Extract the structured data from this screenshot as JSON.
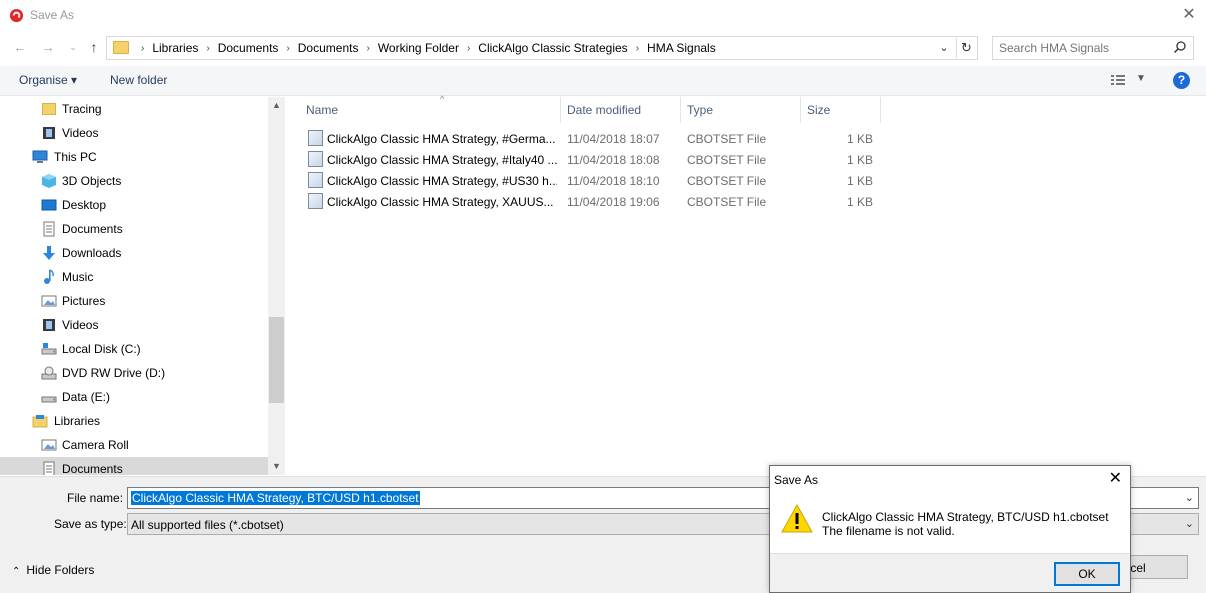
{
  "window": {
    "title": "Save As"
  },
  "address": {
    "crumbs": [
      "Libraries",
      "Documents",
      "Documents",
      "Working Folder",
      "ClickAlgo Classic Strategies",
      "HMA Signals"
    ]
  },
  "search": {
    "placeholder": "Search HMA Signals"
  },
  "toolbar": {
    "organise_label": "Organise ▾",
    "new_folder_label": "New folder",
    "help_label": "?"
  },
  "sidebar": {
    "items": [
      {
        "label": "Tracing",
        "icon": "folder-icon"
      },
      {
        "label": "Videos",
        "icon": "videos-icon"
      },
      {
        "label": "This PC",
        "icon": "pc-icon"
      },
      {
        "label": "3D Objects",
        "icon": "3d-objects-icon"
      },
      {
        "label": "Desktop",
        "icon": "desktop-icon"
      },
      {
        "label": "Documents",
        "icon": "documents-icon"
      },
      {
        "label": "Downloads",
        "icon": "downloads-icon"
      },
      {
        "label": "Music",
        "icon": "music-icon"
      },
      {
        "label": "Pictures",
        "icon": "pictures-icon"
      },
      {
        "label": "Videos",
        "icon": "videos-icon"
      },
      {
        "label": "Local Disk (C:)",
        "icon": "local-disk-icon"
      },
      {
        "label": "DVD RW Drive (D:)",
        "icon": "dvd-drive-icon"
      },
      {
        "label": "Data (E:)",
        "icon": "drive-icon"
      },
      {
        "label": "Libraries",
        "icon": "libraries-icon"
      },
      {
        "label": "Camera Roll",
        "icon": "camera-roll-icon"
      },
      {
        "label": "Documents",
        "icon": "documents-icon",
        "selected": true
      }
    ]
  },
  "filelist": {
    "columns": [
      "Name",
      "Date modified",
      "Type",
      "Size"
    ],
    "rows": [
      {
        "name": "ClickAlgo Classic HMA Strategy, #Germa...",
        "date": "11/04/2018 18:07",
        "type": "CBOTSET File",
        "size": "1 KB"
      },
      {
        "name": "ClickAlgo Classic HMA Strategy, #Italy40 ...",
        "date": "11/04/2018 18:08",
        "type": "CBOTSET File",
        "size": "1 KB"
      },
      {
        "name": "ClickAlgo Classic HMA Strategy, #US30 h...",
        "date": "11/04/2018 18:10",
        "type": "CBOTSET File",
        "size": "1 KB"
      },
      {
        "name": "ClickAlgo Classic HMA Strategy, XAUUS...",
        "date": "11/04/2018 19:06",
        "type": "CBOTSET File",
        "size": "1 KB"
      }
    ]
  },
  "bottom": {
    "filename_label": "File name:",
    "filename_value": "ClickAlgo Classic HMA Strategy, BTC/USD h1.cbotset",
    "savetype_label": "Save as type:",
    "savetype_value": "All supported files (*.cbotset)",
    "hide_folders_label": "Hide Folders",
    "cancel_label": "ancel"
  },
  "modal": {
    "title": "Save As",
    "message_line1": "ClickAlgo Classic HMA Strategy, BTC/USD h1.cbotset",
    "message_line2": "The filename is not valid.",
    "ok_label": "OK"
  },
  "colors": {
    "accent": "#0078d7",
    "help": "#1c6ad6",
    "warning": "#ffd700"
  }
}
